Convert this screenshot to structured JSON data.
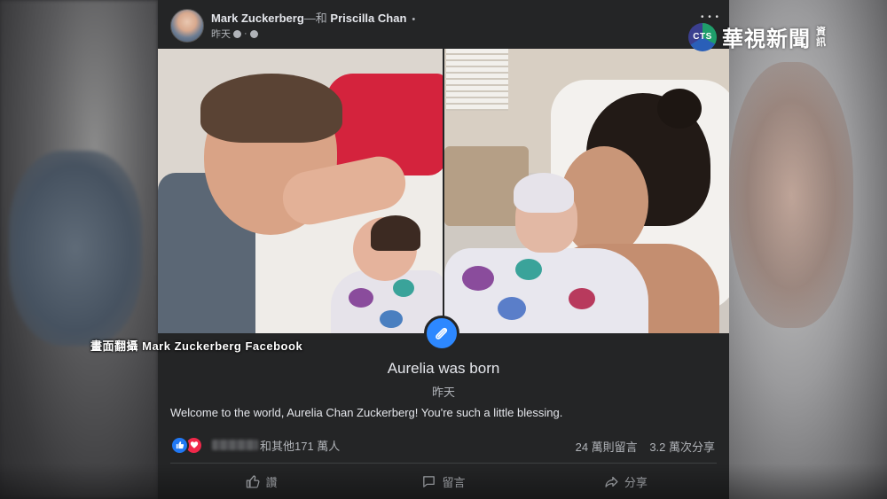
{
  "post": {
    "author": "Mark Zuckerberg",
    "with_text": "—和",
    "tagged": "Priscilla Chan",
    "timestamp": "昨天",
    "meta_separator": "·",
    "life_event_title": "Aurelia was born",
    "life_event_date": "昨天",
    "text": "Welcome to the world, Aurelia Chan Zuckerberg! You're such a little blessing.",
    "reactions_text": "和其他171 萬人",
    "comments_count": "24 萬則留言",
    "shares_count": "3.2 萬次分享",
    "actions": {
      "like": "讚",
      "comment": "留言",
      "share": "分享"
    }
  },
  "overlay": {
    "brand_logo": "CTS",
    "brand_name": "華視新聞",
    "brand_sub_1": "資",
    "brand_sub_2": "訊",
    "brand_dots": "• • •",
    "caption": "畫面翻攝 Mark Zuckerberg Facebook"
  },
  "colors": {
    "card_bg": "#242526",
    "accent_blue": "#2d88ff",
    "like_blue": "#2078f4",
    "love_red": "#f0284a"
  },
  "icons": [
    "globe-icon",
    "clock-icon",
    "baby-bottle-icon",
    "like-icon",
    "love-icon",
    "thumbs-up-icon",
    "comment-icon",
    "share-icon"
  ]
}
